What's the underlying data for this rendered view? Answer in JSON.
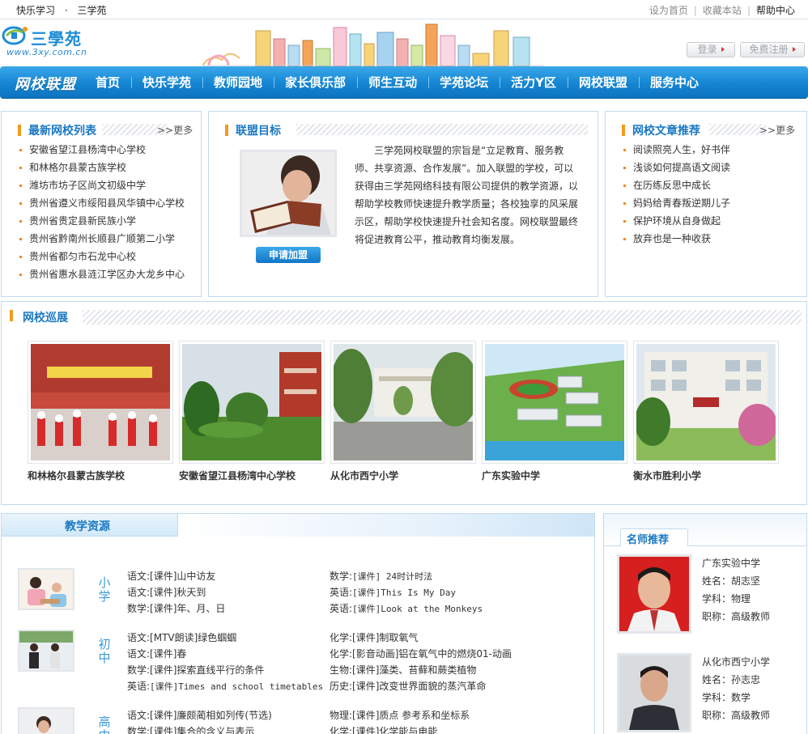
{
  "topbar": {
    "links_left": [
      "快乐学习",
      "·",
      "三学苑"
    ],
    "links_right": [
      "设为首页",
      "收藏本站",
      "帮助中心"
    ]
  },
  "logo": {
    "name": "三學苑",
    "url": "www.3xy.com.cn"
  },
  "header": {
    "login": "登录",
    "register": "免费注册"
  },
  "nav": {
    "brand": "网校联盟",
    "items": [
      "首页",
      "快乐学苑",
      "教师园地",
      "家长俱乐部",
      "师生互动",
      "学苑论坛",
      "活力Y区",
      "网校联盟",
      "服务中心"
    ]
  },
  "school_list": {
    "title": "最新网校列表",
    "more": "更多",
    "items": [
      "安徽省望江县杨湾中心学校",
      "和林格尔县蒙古族学校",
      "潍坊市坊子区尚文初级中学",
      "贵州省遵义市绥阳县风华镇中心学校",
      "贵州省贵定县新民族小学",
      "贵州省黔南州长顺县广顺第二小学",
      "贵州省都匀市石龙中心校",
      "贵州省惠水县涟江学区办大龙乡中心"
    ]
  },
  "alliance_goal": {
    "title": "联盟目标",
    "button": "申请加盟",
    "text": "三学苑网校联盟的宗旨是“立足教育、服务教师、共享资源、合作发展”。加入联盟的学校，可以获得由三学苑网络科技有限公司提供的教学资源，以帮助学校教师快速提升教学质量；各校独享的风采展示区，帮助学校快速提升社会知名度。网校联盟最终将促进教育公平，推动教育均衡发展。"
  },
  "articles": {
    "title": "网校文章推荐",
    "more": "更多",
    "items": [
      "阅读照亮人生，好书伴",
      "浅谈如何提高语文阅读",
      "在历练反思中成长",
      "妈妈给青春叛逆期儿子",
      "保护环境从自身做起",
      "放弃也是一种收获"
    ]
  },
  "showcase": {
    "title": "网校巡展",
    "items": [
      "和林格尔县蒙古族学校",
      "安徽省望江县杨湾中心学校",
      "从化市西宁小学",
      "广东实验中学",
      "衡水市胜利小学"
    ]
  },
  "resources": {
    "title": "教学资源",
    "levels": [
      {
        "name": "小学",
        "col1": [
          [
            "语文:",
            "[课件]山中访友"
          ],
          [
            "语文:",
            "[课件]秋天到"
          ],
          [
            "数学:",
            "[课件]年、月、日"
          ]
        ],
        "col2": [
          [
            "数学:",
            "[课件] 24时计时法"
          ],
          [
            "英语:",
            "[课件]This Is My Day"
          ],
          [
            "英语:",
            "[课件]Look at the Monkeys"
          ]
        ]
      },
      {
        "name": "初中",
        "col1": [
          [
            "语文:",
            "[MTV朗读]绿色蝈蝈"
          ],
          [
            "语文:",
            "[课件]春"
          ],
          [
            "数学:",
            "[课件]探索直线平行的条件"
          ],
          [
            "英语:",
            "[课件]Times and school timetables"
          ]
        ],
        "col2": [
          [
            "化学:",
            "[课件]制取氧气"
          ],
          [
            "化学:",
            "[影音动画]铝在氧气中的燃烧01-动画"
          ],
          [
            "生物:",
            "[课件]藻类、苔藓和蕨类植物"
          ],
          [
            "历史:",
            "[课件]改变世界面貌的蒸汽革命"
          ]
        ]
      },
      {
        "name": "高中",
        "col1": [
          [
            "语文:",
            "[课件]廉颇蔺相如列传(节选)"
          ],
          [
            "数学:",
            "[课件]集合的含义与表示"
          ]
        ],
        "col2": [
          [
            "物理:",
            "[课件]质点 参考系和坐标系"
          ],
          [
            "化学:",
            "[课件]化学能与电能"
          ]
        ]
      }
    ]
  },
  "teachers": {
    "title": "名师推荐",
    "items": [
      {
        "school": "广东实验中学",
        "name": "姓名：胡志坚",
        "subject": "学科：物理",
        "title": "职称：高级教师"
      },
      {
        "school": "从化市西宁小学",
        "name": "姓名：孙志忠",
        "subject": "学科：数学",
        "title": "职称：高级教师"
      }
    ]
  },
  "colors": {
    "brand_blue": "#1585d2",
    "accent_orange": "#f39a1e",
    "title_blue": "#1a78c2"
  }
}
